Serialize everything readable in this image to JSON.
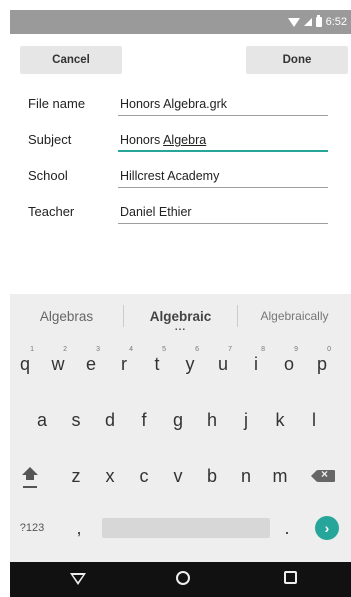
{
  "status": {
    "time": "6:52",
    "icons": [
      "wifi-icon",
      "signal-icon",
      "battery-icon"
    ]
  },
  "toolbar": {
    "cancel_label": "Cancel",
    "done_label": "Done"
  },
  "form": {
    "fields": [
      {
        "label": "File name",
        "value": "Honors Algebra.grk"
      },
      {
        "label": "Subject",
        "value_plain": "Honors ",
        "value_underlined": "Algebra"
      },
      {
        "label": "School",
        "value": "Hillcrest Academy"
      },
      {
        "label": "Teacher",
        "value": "Daniel Ethier"
      }
    ],
    "accent_color": "#26a69a"
  },
  "keyboard": {
    "suggestions": [
      "Algebras",
      "Algebraic",
      "Algebraically"
    ],
    "row1": [
      {
        "k": "q",
        "h": "1"
      },
      {
        "k": "w",
        "h": "2"
      },
      {
        "k": "e",
        "h": "3"
      },
      {
        "k": "r",
        "h": "4"
      },
      {
        "k": "t",
        "h": "5"
      },
      {
        "k": "y",
        "h": "6"
      },
      {
        "k": "u",
        "h": "7"
      },
      {
        "k": "i",
        "h": "8"
      },
      {
        "k": "o",
        "h": "9"
      },
      {
        "k": "p",
        "h": "0"
      }
    ],
    "row2": [
      "a",
      "s",
      "d",
      "f",
      "g",
      "h",
      "j",
      "k",
      "l"
    ],
    "row3": [
      "z",
      "x",
      "c",
      "v",
      "b",
      "n",
      "m"
    ],
    "symbols_label": "?123",
    "comma": ",",
    "period": "."
  }
}
